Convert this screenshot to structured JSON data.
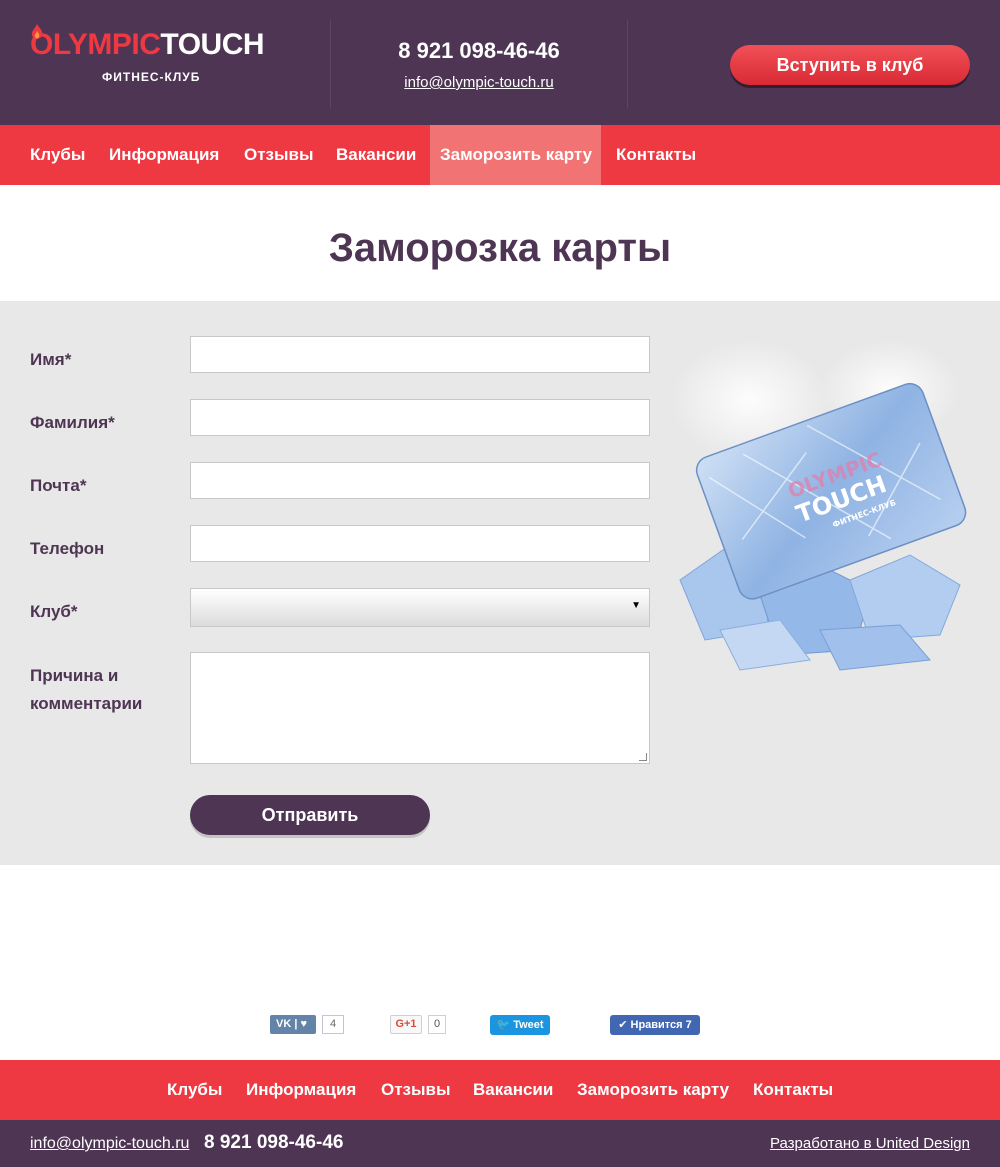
{
  "header": {
    "logo_part1": "OLYMPIC",
    "logo_part2": "TOUCH",
    "logo_sub": "ФИТНЕС-КЛУБ",
    "phone": "8 921 098-46-46",
    "email": "info@olympic-touch.ru",
    "join_label": "Вступить в клуб"
  },
  "nav": {
    "items": [
      "Клубы",
      "Информация",
      "Отзывы",
      "Вакансии",
      "Заморозить карту",
      "Контакты"
    ],
    "active": "Заморозить карту"
  },
  "page": {
    "title": "Заморозка карты"
  },
  "form": {
    "name_label": "Имя*",
    "surname_label": "Фамилия*",
    "email_label": "Почта*",
    "phone_label": "Телефон",
    "club_label": "Клуб*",
    "comment_label": "Причина и комментарии",
    "submit_label": "Отправить",
    "name_value": "",
    "surname_value": "",
    "email_value": "",
    "phone_value": "",
    "club_value": "",
    "comment_value": ""
  },
  "card": {
    "brand_part1": "OLYMPIC",
    "brand_part2": "TOUCH",
    "brand_sub": "ФИТНЕС-КЛУБ"
  },
  "social": {
    "vk_label": "VK",
    "vk_count": "4",
    "gplus_label": "G+1",
    "gplus_count": "0",
    "tweet_label": "Tweet",
    "fb_label": "Нравится 7"
  },
  "footer": {
    "nav_items": [
      "Клубы",
      "Информация",
      "Отзывы",
      "Вакансии",
      "Заморозить карту",
      "Контакты"
    ],
    "email": "info@olympic-touch.ru",
    "phone": "8 921 098-46-46",
    "credit": "Разработано в United Design"
  },
  "colors": {
    "brand_purple": "#4e3553",
    "brand_red": "#ee3842",
    "nav_active": "#f27373",
    "form_bg": "#e8e8e8"
  }
}
